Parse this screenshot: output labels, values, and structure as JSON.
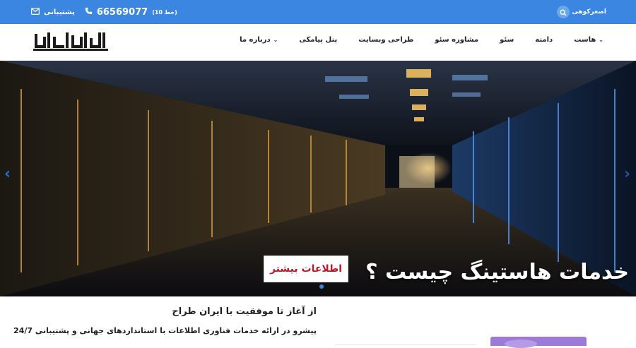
{
  "topbar": {
    "support_label": "پشتیبانی",
    "phone": "66569077",
    "lines": "(10 خط)",
    "account_label": "اصغرکوهی"
  },
  "nav": {
    "items": [
      {
        "label": "هاست",
        "dropdown": true
      },
      {
        "label": "دامنه",
        "dropdown": false
      },
      {
        "label": "سئو",
        "dropdown": false
      },
      {
        "label": "مشاوره سئو",
        "dropdown": false
      },
      {
        "label": "طراحی وبسایت",
        "dropdown": false
      },
      {
        "label": "پنل پیامکی",
        "dropdown": false
      },
      {
        "label": "درباره ما",
        "dropdown": true
      }
    ]
  },
  "hero": {
    "title": "خدمات هاستینگ چیست ؟",
    "button": "اطلاعات بیشتر"
  },
  "content": {
    "heading": "از آغاز تا موفقیت با ایران طراح",
    "subheading": "پیشرو در ارائه خدمات فناوری اطلاعات با استانداردهای جهانی و پشتیبانی 24/7"
  },
  "colors": {
    "brand": "#3a86e0",
    "accent_red": "#c0152a"
  }
}
